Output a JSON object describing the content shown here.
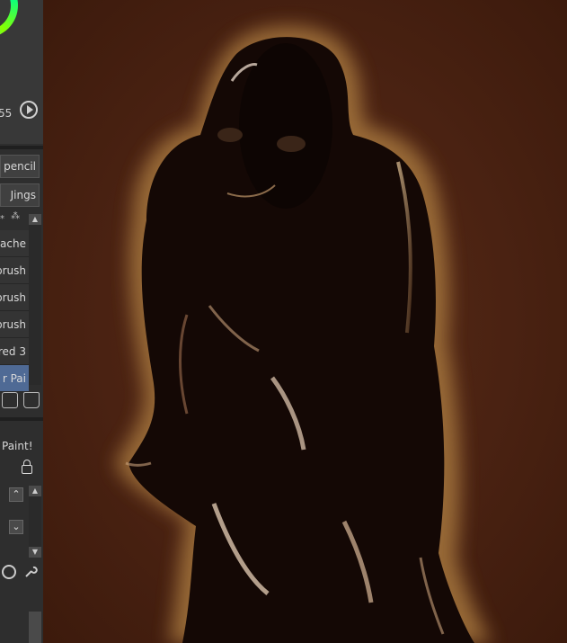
{
  "color_panel": {
    "value_text": "55"
  },
  "brush_fields": [
    {
      "label": "pencil"
    },
    {
      "label": "Jings"
    }
  ],
  "brush_list": [
    {
      "label": "ache"
    },
    {
      "label": "brush"
    },
    {
      "label": "brush"
    },
    {
      "label": "brush"
    },
    {
      "label": "red 3"
    },
    {
      "label": "r Pai",
      "selected": true
    }
  ],
  "layer_panel": {
    "paint_label": "Paint!"
  },
  "colors": {
    "canvas_bg": "#4a2212",
    "panel_bg": "#2e2e2e",
    "selection": "#4f6a95",
    "color_wheel_accent": "#00e5ff"
  }
}
